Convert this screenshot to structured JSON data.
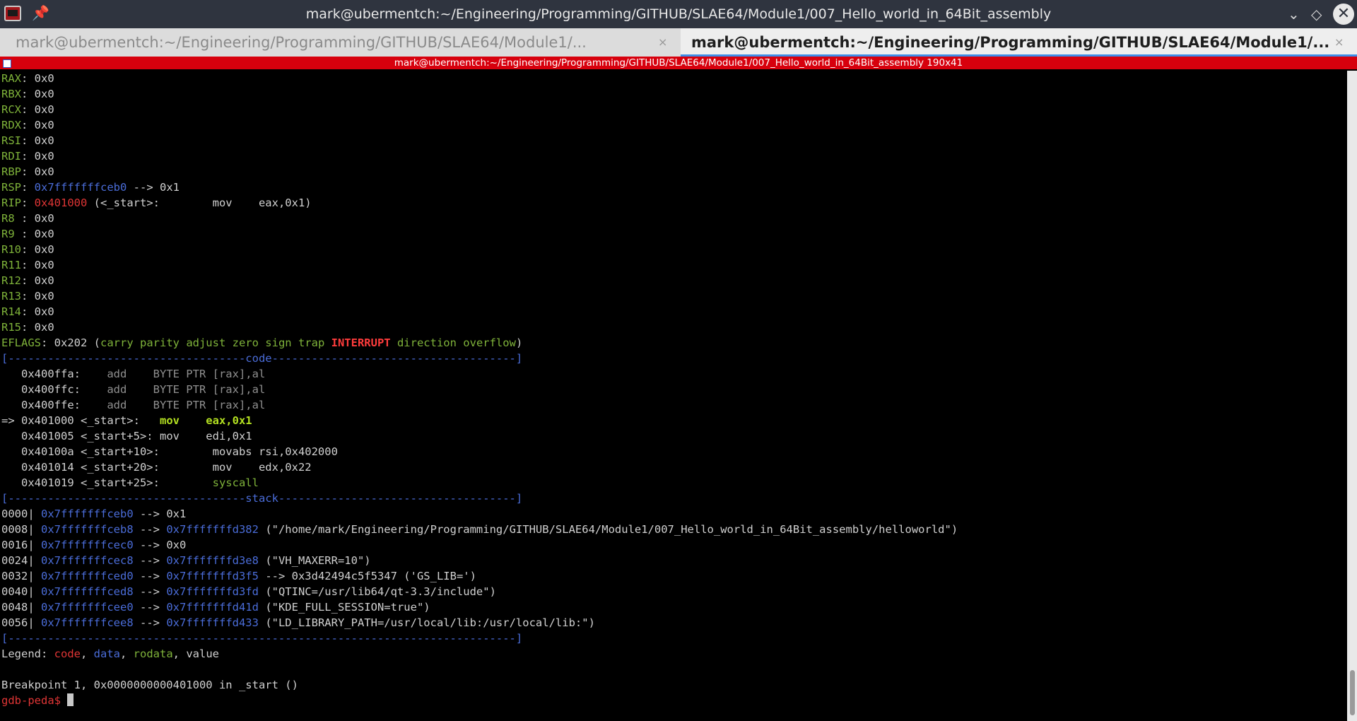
{
  "window": {
    "title": "mark@ubermentch:~/Engineering/Programming/GITHUB/SLAE64/Module1/007_Hello_world_in_64Bit_assembly",
    "minimize_glyph": "⌄",
    "maximize_glyph": "◇",
    "close_glyph": "✕",
    "pin_glyph": "📌"
  },
  "tabs": [
    {
      "label": "mark@ubermentch:~/Engineering/Programming/GITHUB/SLAE64/Module1/...",
      "close": "×",
      "active": false
    },
    {
      "label": "mark@ubermentch:~/Engineering/Programming/GITHUB/SLAE64/Module1/...",
      "close": "×",
      "active": true
    }
  ],
  "session_bar": {
    "text": "mark@ubermentch:~/Engineering/Programming/GITHUB/SLAE64/Module1/007_Hello_world_in_64Bit_assembly 190x41"
  },
  "registers": [
    {
      "name": "RAX",
      "sep": ": ",
      "value": "0x0"
    },
    {
      "name": "RBX",
      "sep": ": ",
      "value": "0x0"
    },
    {
      "name": "RCX",
      "sep": ": ",
      "value": "0x0"
    },
    {
      "name": "RDX",
      "sep": ": ",
      "value": "0x0"
    },
    {
      "name": "RSI",
      "sep": ": ",
      "value": "0x0"
    },
    {
      "name": "RDI",
      "sep": ": ",
      "value": "0x0"
    },
    {
      "name": "RBP",
      "sep": ": ",
      "value": "0x0"
    },
    {
      "name": "RSP",
      "sep": ": ",
      "addr": "0x7fffffffceb0",
      "rest": " --> 0x1"
    },
    {
      "name": "RIP",
      "sep": ": ",
      "code_addr": "0x401000",
      "rest": " (<_start>:        mov    eax,0x1)"
    },
    {
      "name": "R8",
      "sep": " : ",
      "value": "0x0"
    },
    {
      "name": "R9",
      "sep": " : ",
      "value": "0x0"
    },
    {
      "name": "R10",
      "sep": ": ",
      "value": "0x0"
    },
    {
      "name": "R11",
      "sep": ": ",
      "value": "0x0"
    },
    {
      "name": "R12",
      "sep": ": ",
      "value": "0x0"
    },
    {
      "name": "R13",
      "sep": ": ",
      "value": "0x0"
    },
    {
      "name": "R14",
      "sep": ": ",
      "value": "0x0"
    },
    {
      "name": "R15",
      "sep": ": ",
      "value": "0x0"
    }
  ],
  "eflags": {
    "name": "EFLAGS",
    "value": ": 0x202 (",
    "flags_before": "carry parity adjust zero sign trap ",
    "interrupt": "INTERRUPT",
    "flags_after": " direction overflow",
    "close": ")"
  },
  "separators": {
    "code": "[------------------------------------code-------------------------------------]",
    "stack": "[------------------------------------stack------------------------------------]",
    "end": "[-----------------------------------------------------------------------------]"
  },
  "code": [
    {
      "prefix": "   ",
      "addr": "0x400ffa:",
      "gap": "    ",
      "instr": "add    BYTE PTR [rax],al",
      "style": "gray"
    },
    {
      "prefix": "   ",
      "addr": "0x400ffc:",
      "gap": "    ",
      "instr": "add    BYTE PTR [rax],al",
      "style": "gray"
    },
    {
      "prefix": "   ",
      "addr": "0x400ffe:",
      "gap": "    ",
      "instr": "add    BYTE PTR [rax],al",
      "style": "gray"
    },
    {
      "prefix": "=> ",
      "addr": "0x401000 <_start>:",
      "gap": "   ",
      "instr": "mov    eax,0x1",
      "style": "current"
    },
    {
      "prefix": "   ",
      "addr": "0x401005 <_start+5>:",
      "gap": " ",
      "instr": "mov    edi,0x1",
      "style": "white"
    },
    {
      "prefix": "   ",
      "addr": "0x40100a <_start+10>:",
      "gap": "        ",
      "instr": "movabs rsi,0x402000",
      "style": "white"
    },
    {
      "prefix": "   ",
      "addr": "0x401014 <_start+20>:",
      "gap": "        ",
      "instr": "mov    edx,0x22",
      "style": "white"
    },
    {
      "prefix": "   ",
      "addr": "0x401019 <_start+25>:",
      "gap": "        ",
      "instr": "syscall",
      "style": "green"
    }
  ],
  "stack": [
    {
      "off": "0000| ",
      "addr": "0x7fffffffceb0",
      "arrow": " --> ",
      "target": "",
      "rest": "0x1"
    },
    {
      "off": "0008| ",
      "addr": "0x7fffffffceb8",
      "arrow": " --> ",
      "target": "0x7fffffffd382",
      "rest": " (\"/home/mark/Engineering/Programming/GITHUB/SLAE64/Module1/007_Hello_world_in_64Bit_assembly/helloworld\")"
    },
    {
      "off": "0016| ",
      "addr": "0x7fffffffcec0",
      "arrow": " --> ",
      "target": "",
      "rest": "0x0"
    },
    {
      "off": "0024| ",
      "addr": "0x7fffffffcec8",
      "arrow": " --> ",
      "target": "0x7fffffffd3e8",
      "rest": " (\"VH_MAXERR=10\")"
    },
    {
      "off": "0032| ",
      "addr": "0x7fffffffced0",
      "arrow": " --> ",
      "target": "0x7fffffffd3f5",
      "rest": " --> 0x3d42494c5f5347 ('GS_LIB=')"
    },
    {
      "off": "0040| ",
      "addr": "0x7fffffffced8",
      "arrow": " --> ",
      "target": "0x7fffffffd3fd",
      "rest": " (\"QTINC=/usr/lib64/qt-3.3/include\")"
    },
    {
      "off": "0048| ",
      "addr": "0x7fffffffcee0",
      "arrow": " --> ",
      "target": "0x7fffffffd41d",
      "rest": " (\"KDE_FULL_SESSION=true\")"
    },
    {
      "off": "0056| ",
      "addr": "0x7fffffffcee8",
      "arrow": " --> ",
      "target": "0x7fffffffd433",
      "rest": " (\"LD_LIBRARY_PATH=/usr/local/lib:/usr/local/lib:\")"
    }
  ],
  "legend": {
    "label": "Legend: ",
    "code": "code",
    "comma1": ", ",
    "data": "data",
    "comma2": ", ",
    "rodata": "rodata",
    "comma3": ", ",
    "value": "value"
  },
  "breakpoint": "Breakpoint 1, 0x0000000000401000 in _start ()",
  "prompt": "gdb-peda$ ",
  "colors": {
    "register": "#7fb33a",
    "code": "#e03535",
    "data": "#4a6cd8",
    "rodata": "#7fb33a",
    "title_bar": "#2f343f",
    "session_bar": "#d7000d",
    "active_tab_underline": "#3d8ee8"
  }
}
